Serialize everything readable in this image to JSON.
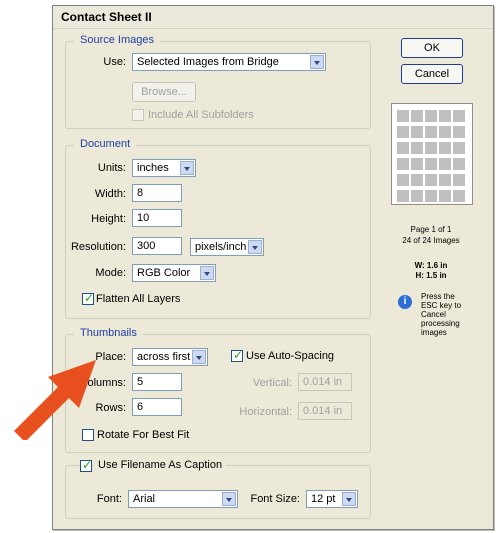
{
  "dialog": {
    "title": "Contact Sheet II",
    "ok_label": "OK",
    "cancel_label": "Cancel"
  },
  "source_images": {
    "legend": "Source Images",
    "use_label": "Use:",
    "use_value": "Selected Images from Bridge",
    "browse_label": "Browse...",
    "include_subfolders_label": "Include All Subfolders"
  },
  "document": {
    "legend": "Document",
    "units_label": "Units:",
    "units_value": "inches",
    "width_label": "Width:",
    "width_value": "8",
    "height_label": "Height:",
    "height_value": "10",
    "resolution_label": "Resolution:",
    "resolution_value": "300",
    "resolution_unit": "pixels/inch",
    "mode_label": "Mode:",
    "mode_value": "RGB Color",
    "flatten_label": "Flatten All Layers"
  },
  "thumbnails": {
    "legend": "Thumbnails",
    "place_label": "Place:",
    "place_value": "across first",
    "auto_spacing_label": "Use Auto-Spacing",
    "columns_label": "Columns:",
    "columns_value": "5",
    "rows_label": "Rows:",
    "rows_value": "6",
    "vertical_label": "Vertical:",
    "vertical_value": "0.014 in",
    "horizontal_label": "Horizontal:",
    "horizontal_value": "0.014 in",
    "rotate_label": "Rotate For Best Fit"
  },
  "caption": {
    "use_filename_label": "Use Filename As Caption",
    "font_label": "Font:",
    "font_value": "Arial",
    "font_size_label": "Font Size:",
    "font_size_value": "12 pt"
  },
  "preview": {
    "page_text": "Page 1 of 1",
    "images_text": "24 of 24 Images",
    "w_text": "W: 1.6 in",
    "h_text": "H: 1.5 in",
    "esc_line1": "Press the",
    "esc_line2": "ESC key to",
    "esc_line3": "Cancel",
    "esc_line4": "processing",
    "esc_line5": "images",
    "grid_columns": 5,
    "grid_rows": 6
  },
  "colors": {
    "callout_arrow": "#e8501f",
    "legend_text": "#1f3ca6",
    "dialog_bg": "#ece9d8"
  },
  "icons": {
    "info": "info-icon",
    "dropdown": "chevron-down-icon",
    "callout": "arrow-callout"
  }
}
